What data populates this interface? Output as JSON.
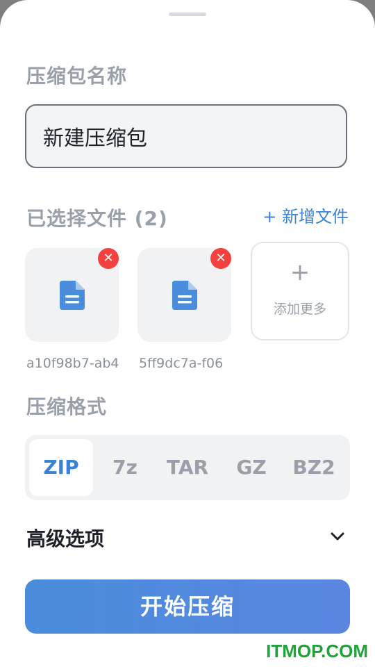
{
  "archive_name": {
    "label": "压缩包名称",
    "value": "新建压缩包"
  },
  "files": {
    "label": "已选择文件 (2)",
    "add_link": "+ 新增文件",
    "items": [
      {
        "name": "a10f98b7-ab4"
      },
      {
        "name": "5ff9dc7a-f06"
      }
    ],
    "remove_glyph": "✕",
    "add_more_plus": "+",
    "add_more_label": "添加更多"
  },
  "format": {
    "label": "压缩格式",
    "options": [
      "ZIP",
      "7z",
      "TAR",
      "GZ",
      "BZ2"
    ],
    "selected": "ZIP"
  },
  "advanced": {
    "label": "高级选项"
  },
  "start_button": "开始压缩",
  "watermark": "ITMOP.COM",
  "colors": {
    "accent": "#3a82d6",
    "remove": "#f5413d",
    "watermark": "#21a33a"
  },
  "icons": [
    "document-icon",
    "remove-icon",
    "plus-icon",
    "chevron-down-icon"
  ]
}
